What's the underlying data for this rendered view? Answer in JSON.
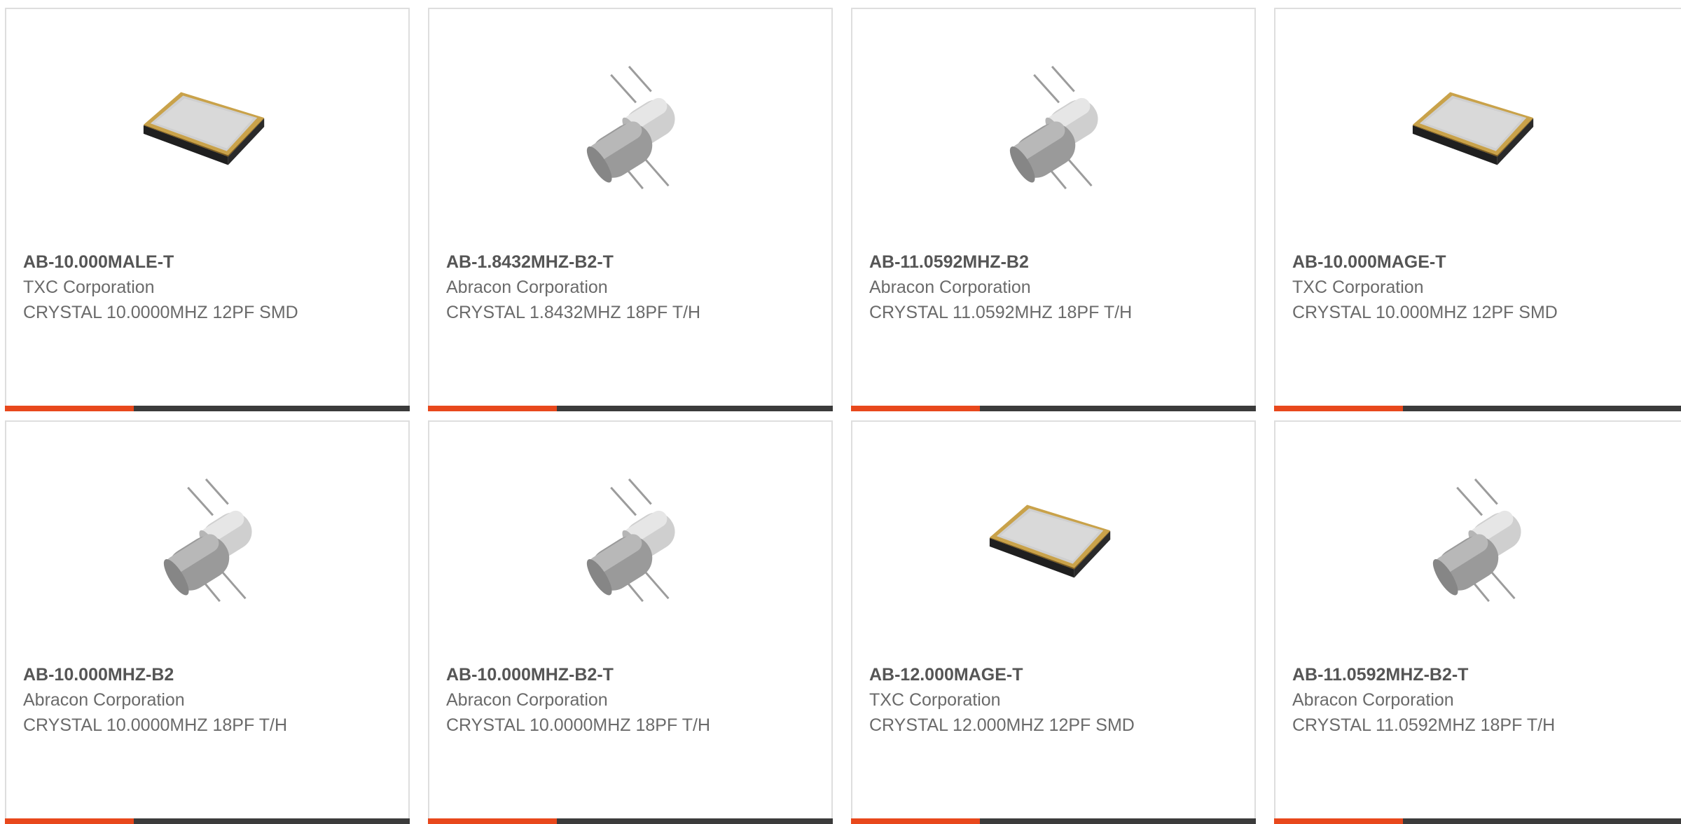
{
  "colors": {
    "accent": "#e8481c",
    "bar_dark": "#3b3b3b",
    "border": "#dedede",
    "part_text": "#555555",
    "body_text": "#6a6a6a"
  },
  "products": [
    {
      "part_number": "AB-10.000MALE-T",
      "manufacturer": "TXC Corporation",
      "description": "CRYSTAL 10.0000MHZ 12PF SMD",
      "icon": "smd-crystal-icon"
    },
    {
      "part_number": "AB-1.8432MHZ-B2-T",
      "manufacturer": "Abracon Corporation",
      "description": "CRYSTAL 1.8432MHZ 18PF T/H",
      "icon": "through-hole-crystal-icon"
    },
    {
      "part_number": "AB-11.0592MHZ-B2",
      "manufacturer": "Abracon Corporation",
      "description": "CRYSTAL 11.0592MHZ 18PF T/H",
      "icon": "through-hole-crystal-icon"
    },
    {
      "part_number": "AB-10.000MAGE-T",
      "manufacturer": "TXC Corporation",
      "description": "CRYSTAL 10.000MHZ 12PF SMD",
      "icon": "smd-crystal-icon"
    },
    {
      "part_number": "AB-10.000MHZ-B2",
      "manufacturer": "Abracon Corporation",
      "description": "CRYSTAL 10.0000MHZ 18PF T/H",
      "icon": "through-hole-crystal-icon"
    },
    {
      "part_number": "AB-10.000MHZ-B2-T",
      "manufacturer": "Abracon Corporation",
      "description": "CRYSTAL 10.0000MHZ 18PF T/H",
      "icon": "through-hole-crystal-icon"
    },
    {
      "part_number": "AB-12.000MAGE-T",
      "manufacturer": "TXC Corporation",
      "description": "CRYSTAL 12.000MHZ 12PF SMD",
      "icon": "smd-crystal-icon"
    },
    {
      "part_number": "AB-11.0592MHZ-B2-T",
      "manufacturer": "Abracon Corporation",
      "description": "CRYSTAL 11.0592MHZ 18PF T/H",
      "icon": "through-hole-crystal-icon"
    }
  ]
}
